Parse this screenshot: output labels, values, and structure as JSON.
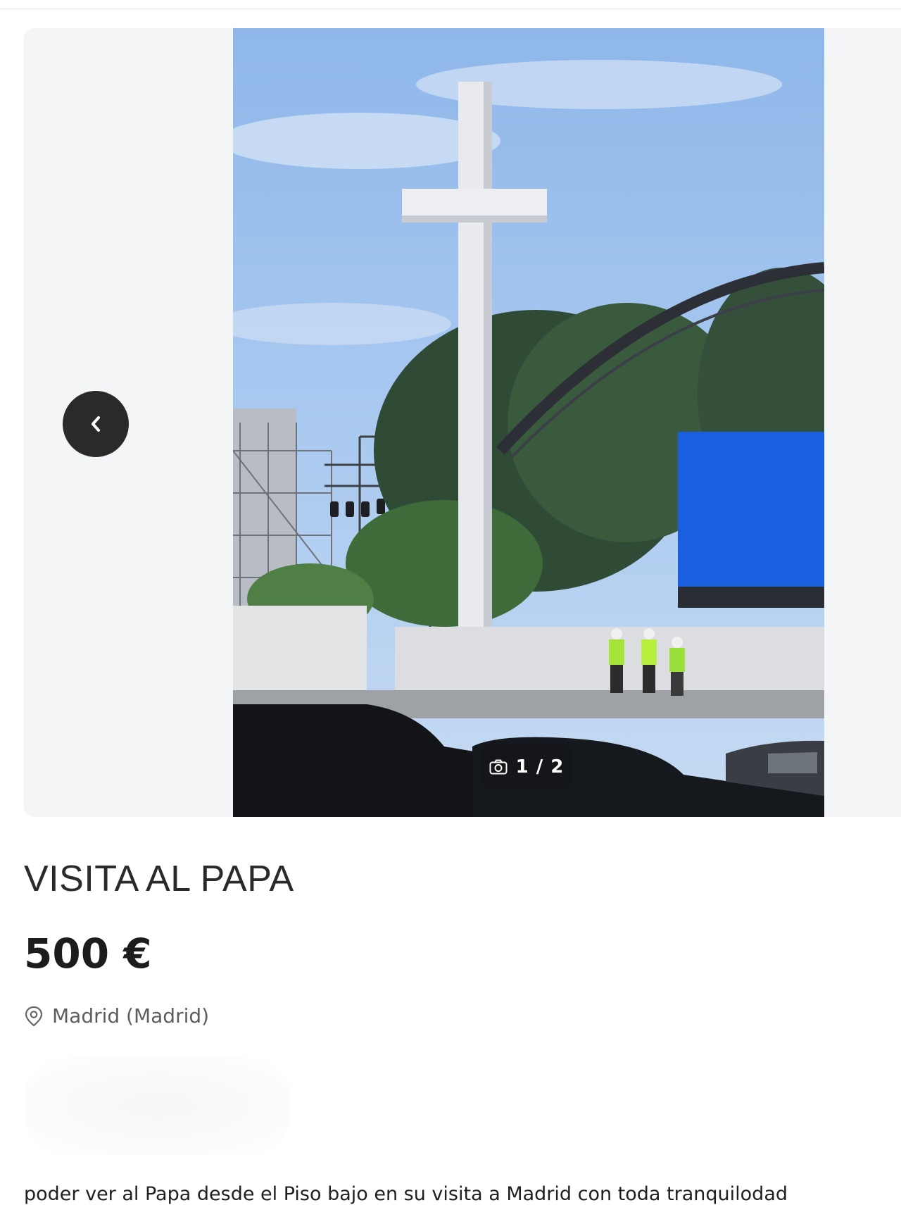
{
  "gallery": {
    "counter": "1 / 2",
    "prev_icon": "chevron-left-icon",
    "camera_icon": "camera-icon",
    "photo_description_icon": "photo"
  },
  "listing": {
    "title": "VISITA AL PAPA",
    "price": "500 €",
    "location": "Madrid (Madrid)",
    "location_icon": "location-pin-icon",
    "description": "poder ver al Papa desde el Piso bajo en su visita a Madrid con toda tranquilodad"
  },
  "colors": {
    "gallery_bg": "#f4f5f7",
    "prev_button_bg": "#2a2a2a",
    "screen_blue": "#1a5fe0"
  }
}
